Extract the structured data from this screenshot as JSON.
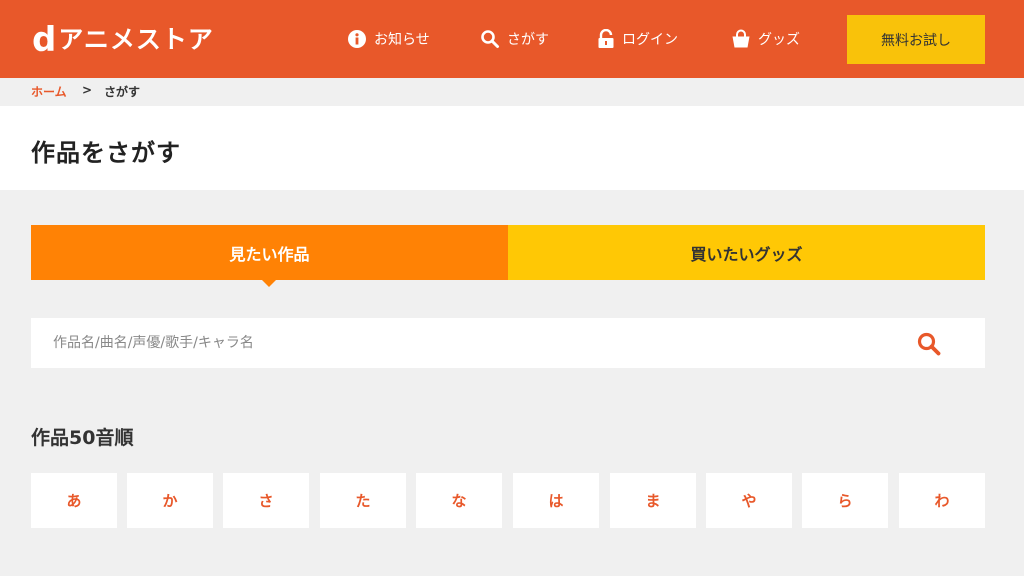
{
  "header": {
    "logo_d": "d",
    "logo_text": "アニメストア",
    "nav": {
      "news": "お知らせ",
      "search": "さがす",
      "login": "ログイン",
      "goods": "グッズ"
    },
    "trial_label": "無料お試し"
  },
  "breadcrumb": {
    "home": "ホーム",
    "separator": ">",
    "current": "さがす"
  },
  "page_title": "作品をさがす",
  "tabs": {
    "watch": "見たい作品",
    "buy": "買いたいグッズ"
  },
  "search": {
    "placeholder": "作品名/曲名/声優/歌手/キャラ名",
    "value": ""
  },
  "section_title": "作品50音順",
  "kana": [
    "あ",
    "か",
    "さ",
    "た",
    "な",
    "は",
    "ま",
    "や",
    "ら",
    "わ"
  ],
  "colors": {
    "brand": "#e8582a",
    "tab_watch": "#ff8205",
    "tab_buy": "#ffc805",
    "trial": "#f9c20a"
  }
}
